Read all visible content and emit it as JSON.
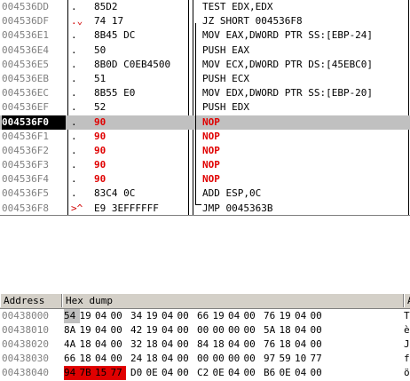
{
  "colors": {
    "selection": "#c0c0c0",
    "patched": "#e00000",
    "address": "#808080"
  },
  "disassembly": [
    {
      "addr": "004536DD",
      "mark": ".",
      "hex": "85D2",
      "ins": "TEST EDX,EDX",
      "red": false,
      "sel": false
    },
    {
      "addr": "004536DF",
      "mark": ".⌄",
      "hex": "74 17",
      "ins": "JZ SHORT 004536F8",
      "red": false,
      "sel": false,
      "markRed": true
    },
    {
      "addr": "004536E1",
      "mark": ".",
      "hex": "8B45 DC",
      "ins": "MOV EAX,DWORD PTR SS:[EBP-24]",
      "red": false,
      "sel": false
    },
    {
      "addr": "004536E4",
      "mark": ".",
      "hex": "50",
      "ins": "PUSH EAX",
      "red": false,
      "sel": false
    },
    {
      "addr": "004536E5",
      "mark": ".",
      "hex": "8B0D C0EB4500",
      "ins": "MOV ECX,DWORD PTR DS:[45EBC0]",
      "red": false,
      "sel": false
    },
    {
      "addr": "004536EB",
      "mark": ".",
      "hex": "51",
      "ins": "PUSH ECX",
      "red": false,
      "sel": false
    },
    {
      "addr": "004536EC",
      "mark": ".",
      "hex": "8B55 E0",
      "ins": "MOV EDX,DWORD PTR SS:[EBP-20]",
      "red": false,
      "sel": false
    },
    {
      "addr": "004536EF",
      "mark": ".",
      "hex": "52",
      "ins": "PUSH EDX",
      "red": false,
      "sel": false
    },
    {
      "addr": "004536F0",
      "mark": ".",
      "hex": "90",
      "ins": "NOP",
      "red": true,
      "sel": true
    },
    {
      "addr": "004536F1",
      "mark": ".",
      "hex": "90",
      "ins": "NOP",
      "red": true,
      "sel": false
    },
    {
      "addr": "004536F2",
      "mark": ".",
      "hex": "90",
      "ins": "NOP",
      "red": true,
      "sel": false
    },
    {
      "addr": "004536F3",
      "mark": ".",
      "hex": "90",
      "ins": "NOP",
      "red": true,
      "sel": false
    },
    {
      "addr": "004536F4",
      "mark": ".",
      "hex": "90",
      "ins": "NOP",
      "red": true,
      "sel": false
    },
    {
      "addr": "004536F5",
      "mark": ".",
      "hex": "83C4 0C",
      "ins": "ADD ESP,0C",
      "red": false,
      "sel": false
    },
    {
      "addr": "004536F8",
      "mark": ">^",
      "hex": "E9 3EFFFFFF",
      "ins": "JMP 0045363B",
      "red": false,
      "sel": false,
      "markRed": true
    }
  ],
  "dump": {
    "headers": {
      "address": "Address",
      "hex": "Hex dump",
      "trail": "A"
    },
    "rows": [
      {
        "addr": "00438000",
        "bytes": [
          "54",
          "19",
          "04",
          "00",
          "34",
          "19",
          "04",
          "00",
          "66",
          "19",
          "04",
          "00",
          "76",
          "19",
          "04",
          "00"
        ],
        "trail": "T"
      },
      {
        "addr": "00438010",
        "bytes": [
          "8A",
          "19",
          "04",
          "00",
          "42",
          "19",
          "04",
          "00",
          "00",
          "00",
          "00",
          "00",
          "5A",
          "18",
          "04",
          "00"
        ],
        "trail": "è"
      },
      {
        "addr": "00438020",
        "bytes": [
          "4A",
          "18",
          "04",
          "00",
          "32",
          "18",
          "04",
          "00",
          "84",
          "18",
          "04",
          "00",
          "76",
          "18",
          "04",
          "00"
        ],
        "trail": "J"
      },
      {
        "addr": "00438030",
        "bytes": [
          "66",
          "18",
          "04",
          "00",
          "24",
          "18",
          "04",
          "00",
          "00",
          "00",
          "00",
          "00",
          "97",
          "59",
          "10",
          "77"
        ],
        "trail": "f"
      },
      {
        "addr": "00438040",
        "bytes": [
          "94",
          "7B",
          "15",
          "77",
          "D0",
          "0E",
          "04",
          "00",
          "C2",
          "0E",
          "04",
          "00",
          "B6",
          "0E",
          "04",
          "00"
        ],
        "trail": "ö"
      }
    ]
  }
}
